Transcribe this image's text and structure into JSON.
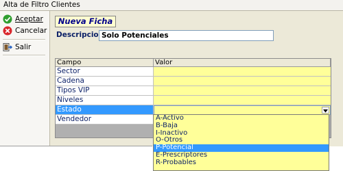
{
  "window": {
    "title": "Alta de Filtro Clientes"
  },
  "toolbar": {
    "aceptar": "Aceptar",
    "cancelar": "Cancelar",
    "salir": "Salir"
  },
  "header": {
    "badge": "Nueva Ficha",
    "desc_label": "Descripcion",
    "desc_value": "Solo Potenciales"
  },
  "grid": {
    "columns": [
      "Campo",
      "Valor"
    ],
    "rows": [
      {
        "campo": "Sector",
        "valor": ""
      },
      {
        "campo": "Cadena",
        "valor": ""
      },
      {
        "campo": "Tipos VIP",
        "valor": ""
      },
      {
        "campo": "Niveles",
        "valor": ""
      },
      {
        "campo": "Estado",
        "valor": ""
      },
      {
        "campo": "Vendedor",
        "valor": ""
      }
    ],
    "selected_row": 4
  },
  "dropdown": {
    "options": [
      "A-Activo",
      "B-Baja",
      "I-Inactivo",
      "O-Otros",
      "P-Potencial",
      "E-Prescriptores",
      "R-Probables"
    ],
    "highlighted": 4
  },
  "colors": {
    "value_cell": "#ffff99",
    "selection": "#3399ff",
    "label_text": "#0a1f66"
  }
}
